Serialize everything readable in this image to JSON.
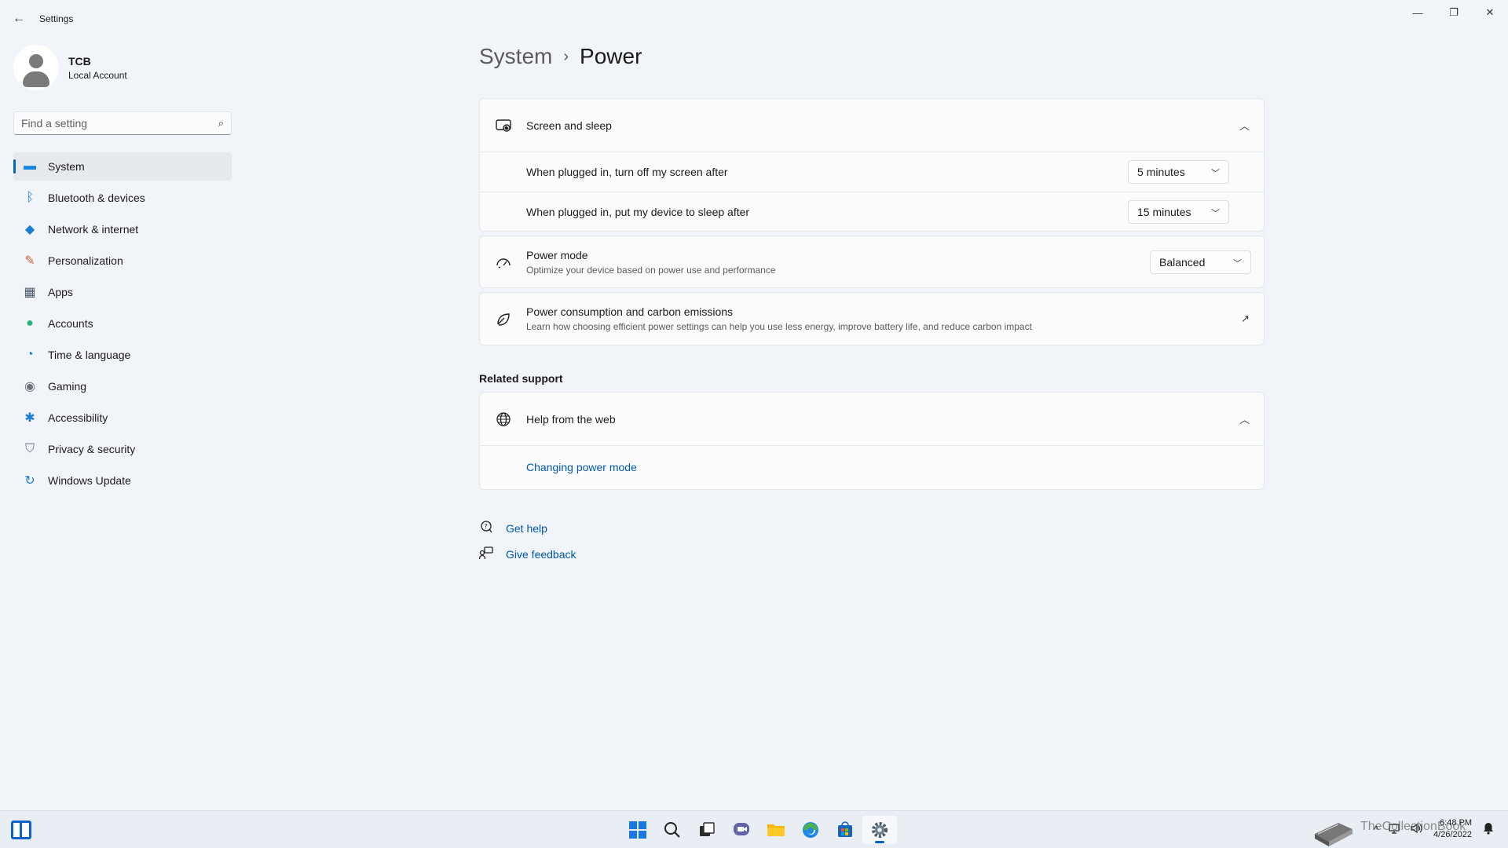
{
  "window": {
    "title": "Settings",
    "back_glyph": "←",
    "minimize_glyph": "—",
    "maximize_glyph": "❐",
    "close_glyph": "✕"
  },
  "profile": {
    "name": "TCB",
    "account_type": "Local Account"
  },
  "search": {
    "placeholder": "Find a setting",
    "icon": "search-icon"
  },
  "sidebar": {
    "items": [
      {
        "label": "System",
        "icon": "system-icon",
        "glyph": "▬",
        "color": "#1a86d9",
        "active": true
      },
      {
        "label": "Bluetooth & devices",
        "icon": "bluetooth-icon",
        "glyph": "ᛒ",
        "color": "#1a7fd4",
        "active": false
      },
      {
        "label": "Network & internet",
        "icon": "wifi-icon",
        "glyph": "◆",
        "color": "#1a7fd4",
        "active": false
      },
      {
        "label": "Personalization",
        "icon": "brush-icon",
        "glyph": "✎",
        "color": "#c9663a",
        "active": false
      },
      {
        "label": "Apps",
        "icon": "apps-icon",
        "glyph": "▦",
        "color": "#4a5668",
        "active": false
      },
      {
        "label": "Accounts",
        "icon": "person-icon",
        "glyph": "●",
        "color": "#2bb27a",
        "active": false
      },
      {
        "label": "Time & language",
        "icon": "clock-globe-icon",
        "glyph": "◔",
        "color": "#1a7fd4",
        "active": false
      },
      {
        "label": "Gaming",
        "icon": "gamepad-icon",
        "glyph": "◉",
        "color": "#6b7280",
        "active": false
      },
      {
        "label": "Accessibility",
        "icon": "accessibility-icon",
        "glyph": "✱",
        "color": "#1a7fd4",
        "active": false
      },
      {
        "label": "Privacy & security",
        "icon": "shield-icon",
        "glyph": "⛉",
        "color": "#6b7280",
        "active": false
      },
      {
        "label": "Windows Update",
        "icon": "update-icon",
        "glyph": "↻",
        "color": "#1a7fd4",
        "active": false
      }
    ]
  },
  "breadcrumb": {
    "parent": "System",
    "separator": "›",
    "current": "Power"
  },
  "screen_sleep": {
    "title": "Screen and sleep",
    "icon": "monitor-sleep-icon",
    "expanded": true,
    "chevron_glyph": "︿",
    "rows": [
      {
        "label": "When plugged in, turn off my screen after",
        "value": "5 minutes"
      },
      {
        "label": "When plugged in, put my device to sleep after",
        "value": "15 minutes"
      }
    ]
  },
  "power_mode": {
    "title": "Power mode",
    "description": "Optimize your device based on power use and performance",
    "value": "Balanced",
    "icon": "gauge-icon"
  },
  "carbon": {
    "title": "Power consumption and carbon emissions",
    "description": "Learn how choosing efficient power settings can help you use less energy, improve battery life, and reduce carbon impact",
    "icon": "leaf-icon",
    "link_glyph": "↗"
  },
  "related": {
    "heading": "Related support",
    "help_title": "Help from the web",
    "help_icon": "globe-icon",
    "links": [
      "Changing power mode"
    ]
  },
  "footer_links": {
    "get_help": "Get help",
    "give_feedback": "Give feedback"
  },
  "taskbar": {
    "caret_glyph": "^",
    "time": "6:48 PM",
    "date": "4/26/2022",
    "watermark": "TheCollectionBook"
  },
  "colors": {
    "accent": "#0067c0",
    "link": "#0058b0"
  }
}
